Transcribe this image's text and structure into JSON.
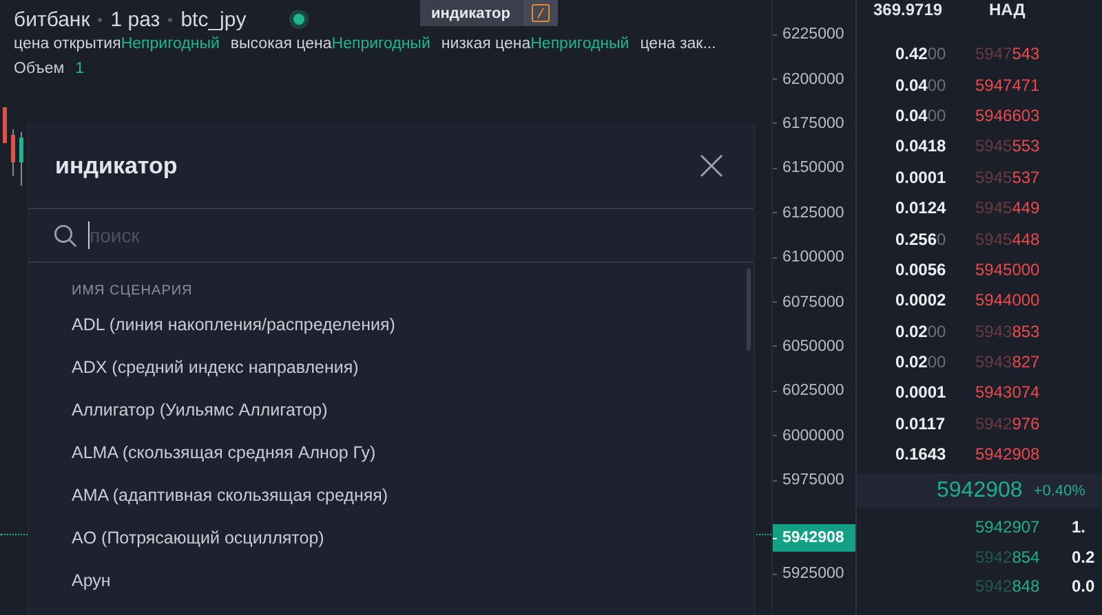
{
  "chart": {
    "title_parts": [
      "битбанк",
      "1 раз",
      "btc_jpy"
    ],
    "live": true,
    "toolbar": {
      "tooltip": "индикатор"
    },
    "legend": [
      {
        "label": "цена открытия",
        "value": "Непригодный"
      },
      {
        "label": "высокая цена",
        "value": "Непригодный"
      },
      {
        "label": "низкая цена",
        "value": "Непригодный"
      },
      {
        "label": "цена зак..."
      }
    ],
    "volume": {
      "label": "Объем",
      "value": "1"
    }
  },
  "dialog": {
    "title": "индикатор",
    "search": {
      "placeholder": "поиск"
    },
    "list_header": "ИМЯ СЦЕНАРИЯ",
    "items": [
      "ADL (линия накопления/распределения)",
      "ADX (средний индекс направления)",
      "Аллигатор (Уильямс Аллигатор)",
      "ALMA (скользящая средняя Алнор Гу)",
      "AMA (адаптивная скользящая средняя)",
      "AO (Потрясающий осциллятор)",
      "Арун"
    ]
  },
  "price_axis": {
    "labels_above": [
      "6225000",
      "6200000",
      "6175000",
      "6150000",
      "6125000",
      "6100000",
      "6075000",
      "6050000",
      "6025000",
      "6000000",
      "5975000"
    ],
    "current_price": "5942908",
    "labels_below": [
      "5925000"
    ]
  },
  "order_book": {
    "header": [
      "369.9719",
      "НАД"
    ],
    "asks": [
      {
        "amount": "0.42",
        "amount_tail": "00",
        "price_head": "5947",
        "price": "543"
      },
      {
        "amount": "0.04",
        "amount_tail": "00",
        "price": "5947471"
      },
      {
        "amount": "0.04",
        "amount_tail": "00",
        "price": "5946603"
      },
      {
        "amount": "0.0418",
        "price_head": "5945",
        "price": "553"
      },
      {
        "amount": "0.0001",
        "price_head": "5945",
        "price": "537"
      },
      {
        "amount": "0.0124",
        "price_head": "5945",
        "price": "449"
      },
      {
        "amount": "0.256",
        "amount_tail": "0",
        "price_head": "5945",
        "price": "448"
      },
      {
        "amount": "0.0056",
        "price": "5945000"
      },
      {
        "amount": "0.0002",
        "price": "5944000"
      },
      {
        "amount": "0.02",
        "amount_tail": "00",
        "price_head": "5943",
        "price": "853"
      },
      {
        "amount": "0.02",
        "amount_tail": "00",
        "price_head": "5943",
        "price": "827"
      },
      {
        "amount": "0.0001",
        "price": "5943074"
      },
      {
        "amount": "0.0117",
        "price_head": "5942",
        "price": "976"
      },
      {
        "amount": "0.1643",
        "price": "5942908"
      }
    ],
    "last_price": "5942908",
    "change": "+0.40%",
    "bids": [
      {
        "price": "5942907",
        "amount": "1."
      },
      {
        "price_head": "5942",
        "price": "854",
        "amount": "0.2"
      },
      {
        "price_head": "5942",
        "price": "848",
        "amount": "0.0"
      }
    ]
  }
}
